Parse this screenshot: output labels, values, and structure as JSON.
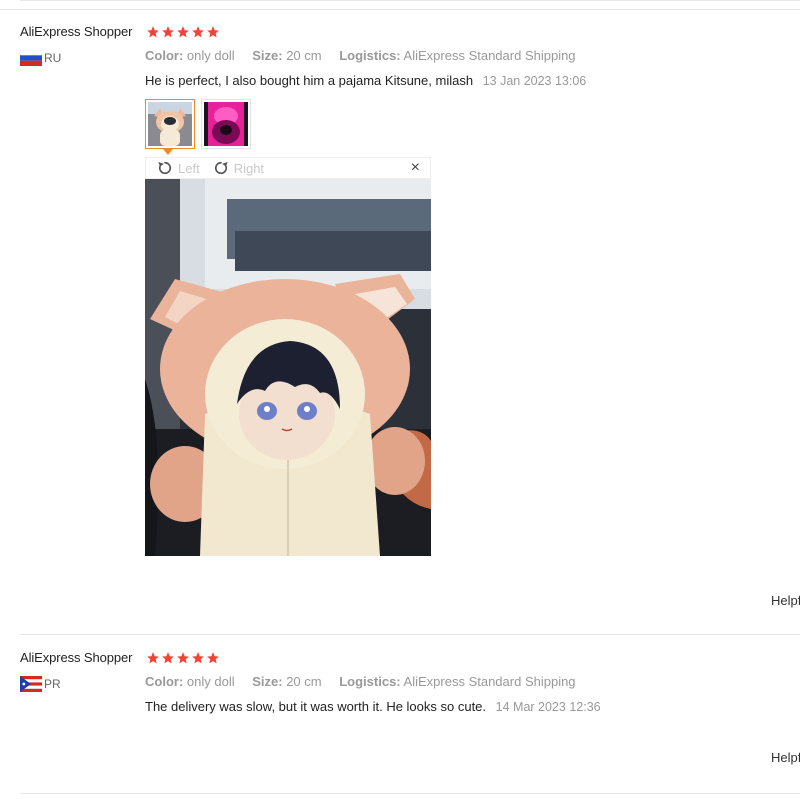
{
  "reviews": [
    {
      "user": "AliExpress Shopper",
      "rating": 5,
      "country": "RU",
      "color_label": "Color:",
      "color_value": "only doll",
      "size_label": "Size:",
      "size_value": "20 cm",
      "logistics_label": "Logistics:",
      "logistics_value": "AliExpress Standard Shipping",
      "text": "He is perfect, I also bought him a pajama Kitsune, milash",
      "timestamp": "13 Jan 2023 13:06",
      "helpful": "Helpf",
      "viewer": {
        "left_label": "Left",
        "right_label": "Right",
        "close": "×"
      }
    },
    {
      "user": "AliExpress Shopper",
      "rating": 5,
      "country": "PR",
      "color_label": "Color:",
      "color_value": "only doll",
      "size_label": "Size:",
      "size_value": "20 cm",
      "logistics_label": "Logistics:",
      "logistics_value": "AliExpress Standard Shipping",
      "text": "The delivery was slow, but it was worth it. He looks so cute.",
      "timestamp": "14 Mar 2023 12:36",
      "helpful": "Helpf"
    }
  ],
  "colors": {
    "star": "#f44336",
    "accent": "#f08a24",
    "muted": "#999999"
  }
}
